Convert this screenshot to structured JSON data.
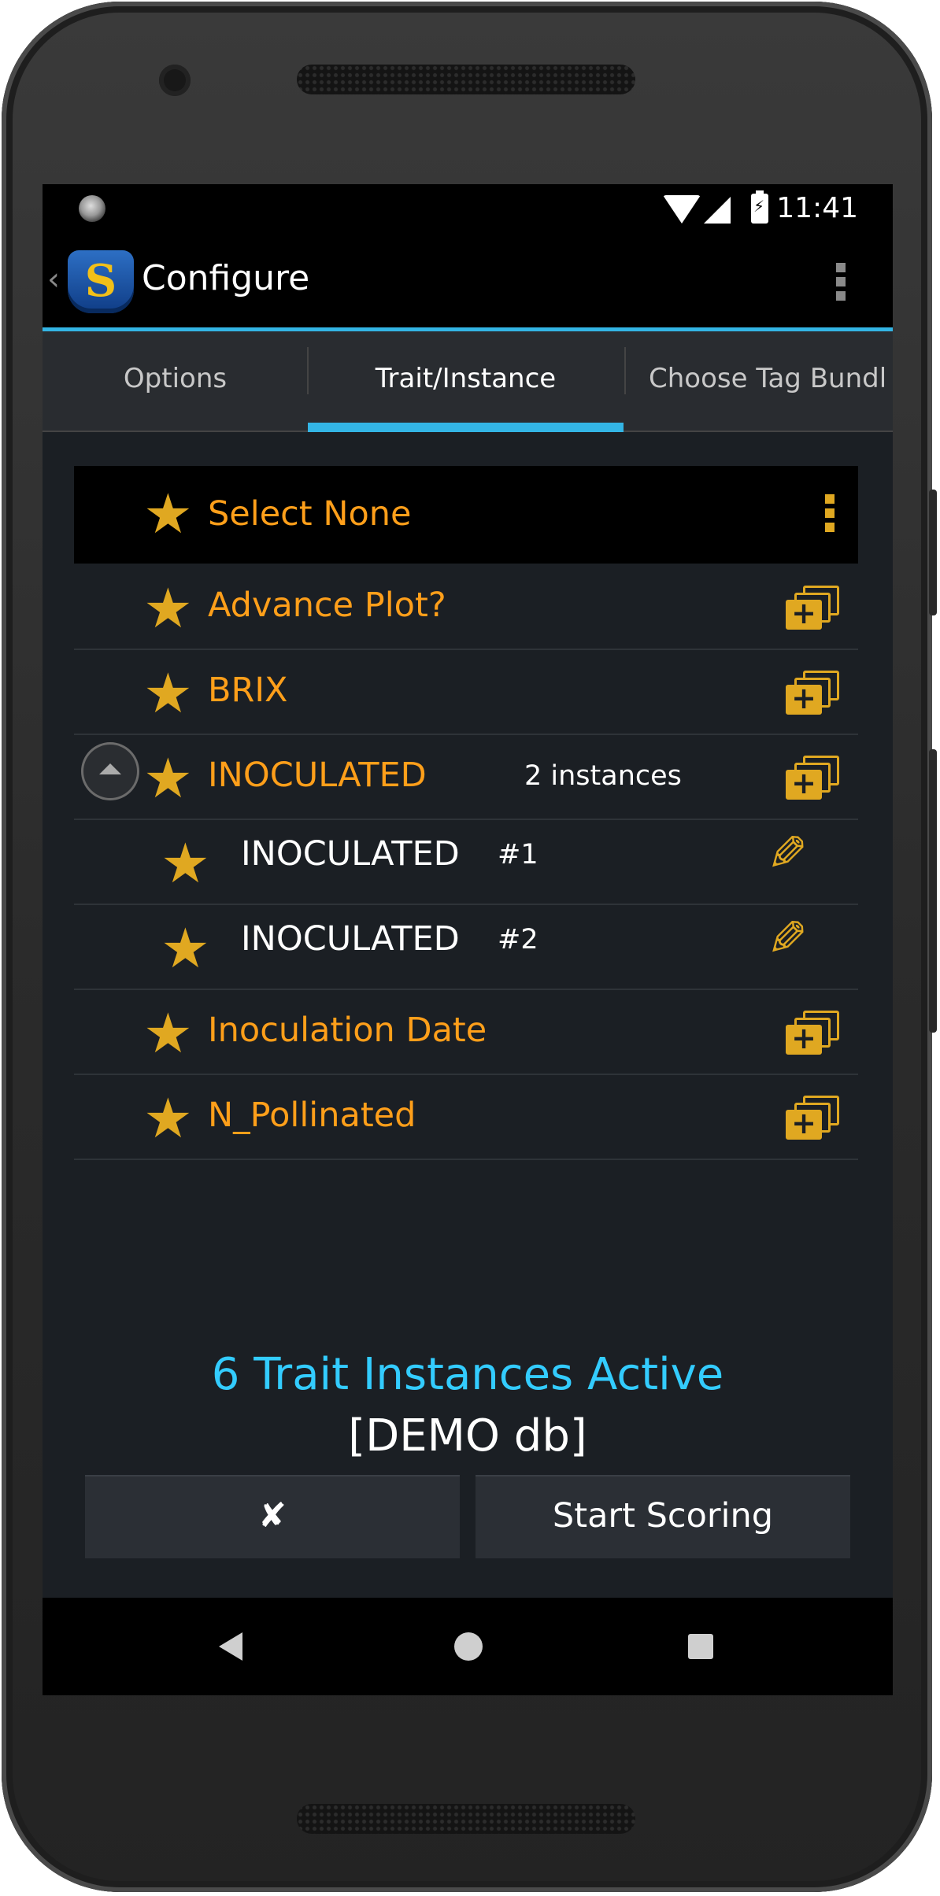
{
  "status_bar": {
    "time": "11:41"
  },
  "action_bar": {
    "up_caret": "‹",
    "logo_letter": "S",
    "title": "Configure"
  },
  "tabs": [
    {
      "label": "Options",
      "selected": false
    },
    {
      "label": "Trait/Instance",
      "selected": true
    },
    {
      "label": "Choose Tag Bundl",
      "selected": false
    }
  ],
  "colors": {
    "accent": "#33b5e5",
    "trait_label": "#ff9f1a",
    "icon_gold": "#e0a821",
    "count_text": "#33ccff"
  },
  "list": {
    "select_none": "Select None",
    "traits": [
      {
        "label": "Advance Plot?"
      },
      {
        "label": "BRIX"
      },
      {
        "label": "INOCULATED",
        "instance_count": "2 instances",
        "expanded": true,
        "instances": [
          {
            "label": "INOCULATED",
            "number": "#1"
          },
          {
            "label": "INOCULATED",
            "number": "#2"
          }
        ]
      },
      {
        "label": "Inoculation Date"
      },
      {
        "label": "N_Pollinated"
      }
    ]
  },
  "footer": {
    "active_count": "6 Trait Instances Active",
    "database": "[DEMO db]",
    "cancel_label": "✘",
    "start_label": "Start Scoring"
  }
}
